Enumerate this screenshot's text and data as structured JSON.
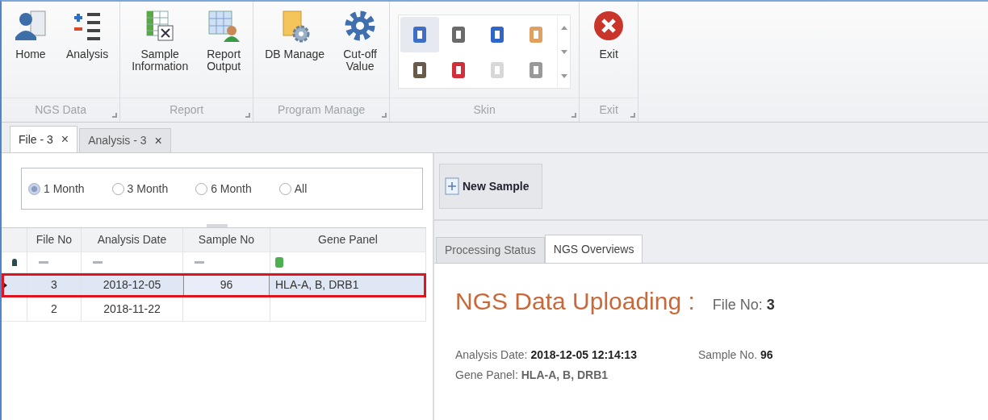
{
  "ribbon": {
    "groups": [
      {
        "label": "NGS Data",
        "buttons": [
          {
            "label": "Home"
          },
          {
            "label": "Analysis"
          }
        ]
      },
      {
        "label": "Report",
        "buttons": [
          {
            "label": "Sample\nInformation"
          },
          {
            "label": "Report\nOutput"
          }
        ]
      },
      {
        "label": "Program Manage",
        "buttons": [
          {
            "label": "DB Manage"
          },
          {
            "label": "Cut-off\nValue"
          }
        ]
      },
      {
        "label": "Skin",
        "kind": "gallery",
        "skins": [
          {
            "selected": true,
            "color": "#3f6fc4"
          },
          {
            "selected": false,
            "color": "#6b6b6b"
          },
          {
            "selected": false,
            "color": "#2f66c8"
          },
          {
            "selected": false,
            "color": "#e0a060"
          },
          {
            "selected": false,
            "color": "#6a5a4a"
          },
          {
            "selected": false,
            "color": "#d0303a"
          },
          {
            "selected": false,
            "color": "#d8d8d8"
          },
          {
            "selected": false,
            "color": "#9a9a9a"
          }
        ]
      },
      {
        "label": "Exit",
        "buttons": [
          {
            "label": "Exit"
          }
        ]
      }
    ]
  },
  "doc_tabs": [
    {
      "label": "File - 3",
      "close": "×",
      "selected": true
    },
    {
      "label": "Analysis - 3",
      "close": "×",
      "selected": false
    }
  ],
  "period_options": [
    {
      "label": "1 Month",
      "selected": true
    },
    {
      "label": "3 Month",
      "selected": false
    },
    {
      "label": "6 Month",
      "selected": false
    },
    {
      "label": "All",
      "selected": false
    }
  ],
  "table": {
    "columns": [
      "File No",
      "Analysis Date",
      "Sample No",
      "Gene Panel"
    ],
    "rows": [
      {
        "cells": [
          "3",
          "2018-12-05",
          "96",
          "HLA-A, B, DRB1"
        ],
        "selected": true,
        "highlighted": true
      },
      {
        "cells": [
          "2",
          "2018-11-22",
          "",
          ""
        ],
        "selected": false,
        "highlighted": false
      }
    ]
  },
  "toolbar": {
    "new_button": "New Sample"
  },
  "detail_tabs": [
    {
      "label": "Processing Status",
      "selected": false
    },
    {
      "label": "NGS Overviews",
      "selected": true
    }
  ],
  "overview": {
    "title": "NGS Data Uploading :",
    "file_label": "File No:",
    "file_value": "3",
    "fields": [
      {
        "label": "Analysis Date:",
        "value": "2018-12-05 12:14:13"
      },
      {
        "label": "Sample No.",
        "value": "96"
      },
      {
        "label": "Gene Panel:",
        "value": "HLA-A, B, DRB1"
      }
    ]
  }
}
